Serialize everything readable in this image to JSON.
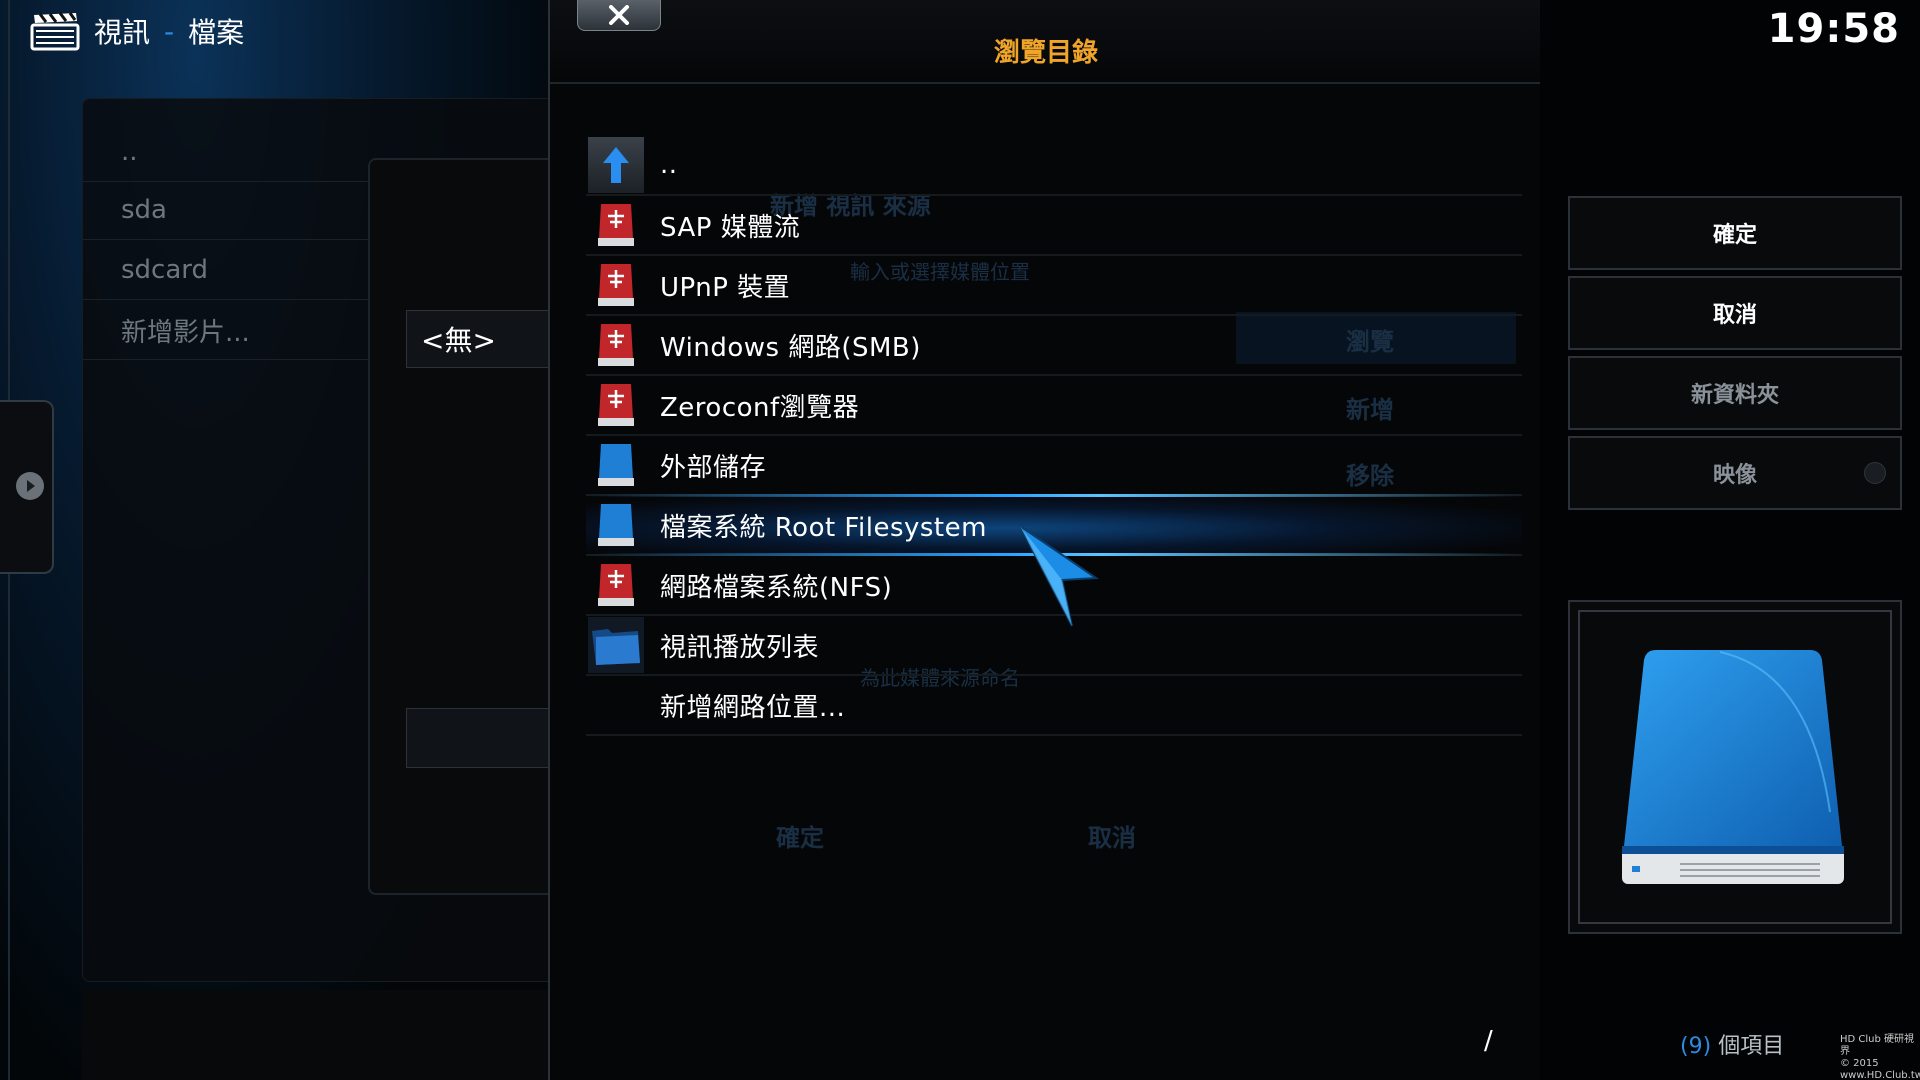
{
  "header": {
    "section": "視訊",
    "separator": "-",
    "subsection": "檔案",
    "icon": "clapperboard-icon"
  },
  "clock": "19:58",
  "background_files": {
    "items": [
      "..",
      "sda",
      "sdcard",
      "新增影片..."
    ]
  },
  "background_dialog": {
    "value_none": "<無>",
    "ghost_title": "新增 視訊 來源",
    "ghost_hint": "輸入或選擇媒體位置",
    "ghost_browse": "瀏覽",
    "ghost_add": "新增",
    "ghost_remove": "移除",
    "ghost_name_hint": "為此媒體來源命名",
    "ghost_ok": "確定",
    "ghost_cancel": "取消"
  },
  "dialog": {
    "title": "瀏覽目錄",
    "close_icon": "close-x-icon",
    "items": [
      {
        "label": "..",
        "icon": "parent-up-arrow-icon"
      },
      {
        "label": "SAP 媒體流",
        "icon": "network-drive-icon"
      },
      {
        "label": "UPnP 裝置",
        "icon": "network-drive-icon"
      },
      {
        "label": "Windows 網路(SMB)",
        "icon": "network-drive-icon"
      },
      {
        "label": "Zeroconf瀏覽器",
        "icon": "network-drive-icon"
      },
      {
        "label": "外部儲存",
        "icon": "drive-icon"
      },
      {
        "label": "檔案系統 Root Filesystem",
        "icon": "drive-icon",
        "selected": true
      },
      {
        "label": "網路檔案系統(NFS)",
        "icon": "network-drive-icon"
      },
      {
        "label": "視訊播放列表",
        "icon": "playlist-folder-icon"
      },
      {
        "label": "新增網路位置...",
        "icon": ""
      }
    ],
    "current_path": "/"
  },
  "buttons": {
    "ok": "確定",
    "cancel": "取消",
    "new_folder": "新資料夾",
    "mirror": "映像"
  },
  "footer": {
    "count_open": "(",
    "count": "9",
    "count_close": ")",
    "count_suffix": "個項目"
  },
  "watermark": {
    "line1": "HD Club 硬研視界",
    "line2": "© 2015  www.HD.Club.tw"
  },
  "colors": {
    "accent_blue": "#2d8ae0",
    "title_orange": "#f0a52a",
    "network_red": "#c0262a",
    "drive_blue": "#1f7fd4"
  }
}
